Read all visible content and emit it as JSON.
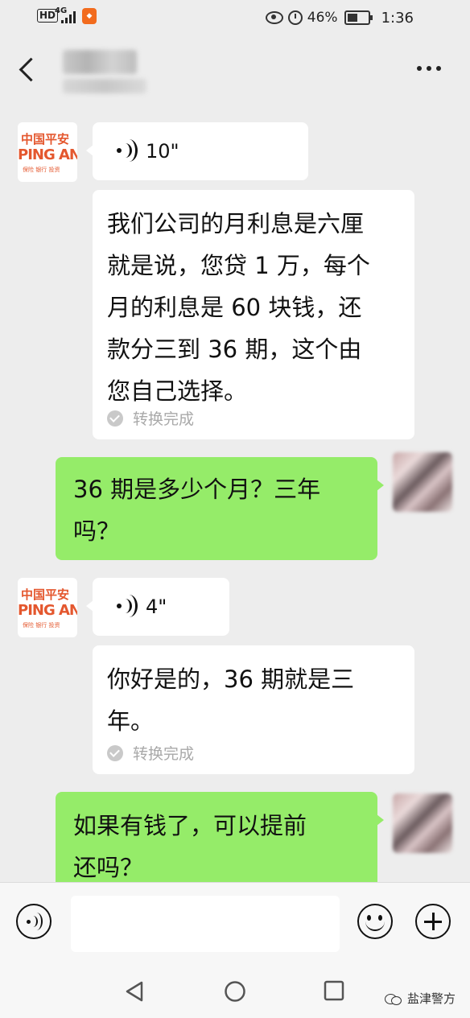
{
  "status_bar": {
    "network_hd": "HD",
    "network_type": "4G",
    "battery_percent": "46%",
    "time": "1:36",
    "icons": [
      "eye-comfort-icon",
      "alarm-icon",
      "battery-icon"
    ]
  },
  "contact": {
    "avatar_brand_cn": "中国平安",
    "avatar_brand_en": "PING AN",
    "avatar_sub": "保险 银行 投资"
  },
  "messages": [
    {
      "side": "left",
      "voice_duration": "10\"",
      "transcript_lines": [
        "我们公司的月利息是六厘",
        "就是说，您贷 1 万，每个",
        "月的利息是 60 块钱，还",
        "款分三到 36 期，这个由",
        "您自己选择。"
      ],
      "status": "转换完成"
    },
    {
      "side": "right",
      "text_lines": [
        "36 期是多少个月？三年",
        "吗？"
      ]
    },
    {
      "side": "left",
      "voice_duration": "4\"",
      "transcript_lines": [
        "你好是的，36 期就是三",
        "年。"
      ],
      "status": "转换完成"
    },
    {
      "side": "right",
      "text_lines": [
        "如果有钱了，可以提前",
        "还吗？"
      ]
    }
  ],
  "input_bar": {
    "placeholder": ""
  },
  "watermark": "盐津警方",
  "colors": {
    "background": "#ededed",
    "bubble_self": "#95ec69",
    "bubble_other": "#ffffff",
    "brand": "#e4572e"
  }
}
